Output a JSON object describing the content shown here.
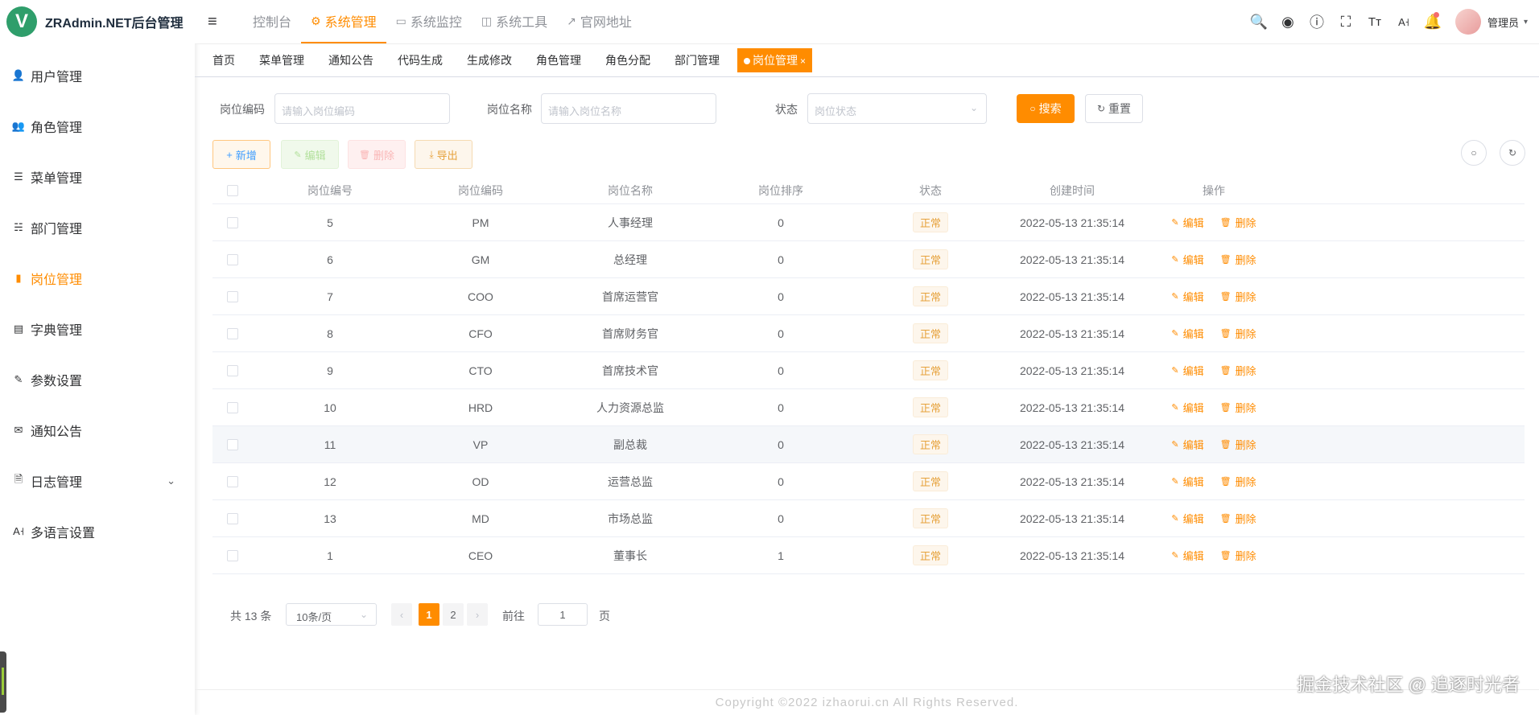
{
  "app": {
    "logo_letter": "V",
    "title": "ZRAdmin.NET后台管理"
  },
  "sidebar": {
    "items": [
      {
        "label": "用户管理",
        "icon": "user-icon"
      },
      {
        "label": "角色管理",
        "icon": "role-icon"
      },
      {
        "label": "菜单管理",
        "icon": "tree-table-icon"
      },
      {
        "label": "部门管理",
        "icon": "tree-icon"
      },
      {
        "label": "岗位管理",
        "icon": "post-icon",
        "active": true
      },
      {
        "label": "字典管理",
        "icon": "dict-icon"
      },
      {
        "label": "参数设置",
        "icon": "edit-icon"
      },
      {
        "label": "通知公告",
        "icon": "message-icon"
      },
      {
        "label": "日志管理",
        "icon": "log-icon",
        "has_children": true
      },
      {
        "label": "多语言设置",
        "icon": "language-icon"
      }
    ]
  },
  "topnav": {
    "tabs": [
      {
        "label": "控制台",
        "icon": ""
      },
      {
        "label": "系统管理",
        "icon": "gear-icon",
        "active": true
      },
      {
        "label": "系统监控",
        "icon": "monitor-icon"
      },
      {
        "label": "系统工具",
        "icon": "toolbox-icon"
      },
      {
        "label": "官网地址",
        "icon": "external-link-icon"
      }
    ],
    "user_name": "管理员"
  },
  "tags": {
    "items": [
      "首页",
      "菜单管理",
      "通知公告",
      "代码生成",
      "生成修改",
      "角色管理",
      "角色分配",
      "部门管理"
    ],
    "active": "岗位管理"
  },
  "search": {
    "post_code_label": "岗位编码",
    "post_code_placeholder": "请输入岗位编码",
    "post_name_label": "岗位名称",
    "post_name_placeholder": "请输入岗位名称",
    "status_label": "状态",
    "status_placeholder": "岗位状态",
    "search_btn": "搜索",
    "reset_btn": "重置"
  },
  "toolbar": {
    "add": "新增",
    "edit": "编辑",
    "delete": "删除",
    "export": "导出"
  },
  "table": {
    "headers": [
      "岗位编号",
      "岗位编码",
      "岗位名称",
      "岗位排序",
      "状态",
      "创建时间",
      "操作"
    ],
    "op_edit": "编辑",
    "op_delete": "删除",
    "rows": [
      {
        "id": "5",
        "code": "PM",
        "name": "人事经理",
        "sort": "0",
        "status": "正常",
        "time": "2022-05-13 21:35:14"
      },
      {
        "id": "6",
        "code": "GM",
        "name": "总经理",
        "sort": "0",
        "status": "正常",
        "time": "2022-05-13 21:35:14"
      },
      {
        "id": "7",
        "code": "COO",
        "name": "首席运营官",
        "sort": "0",
        "status": "正常",
        "time": "2022-05-13 21:35:14"
      },
      {
        "id": "8",
        "code": "CFO",
        "name": "首席财务官",
        "sort": "0",
        "status": "正常",
        "time": "2022-05-13 21:35:14"
      },
      {
        "id": "9",
        "code": "CTO",
        "name": "首席技术官",
        "sort": "0",
        "status": "正常",
        "time": "2022-05-13 21:35:14"
      },
      {
        "id": "10",
        "code": "HRD",
        "name": "人力资源总监",
        "sort": "0",
        "status": "正常",
        "time": "2022-05-13 21:35:14"
      },
      {
        "id": "11",
        "code": "VP",
        "name": "副总裁",
        "sort": "0",
        "status": "正常",
        "time": "2022-05-13 21:35:14"
      },
      {
        "id": "12",
        "code": "OD",
        "name": "运营总监",
        "sort": "0",
        "status": "正常",
        "time": "2022-05-13 21:35:14"
      },
      {
        "id": "13",
        "code": "MD",
        "name": "市场总监",
        "sort": "0",
        "status": "正常",
        "time": "2022-05-13 21:35:14"
      },
      {
        "id": "1",
        "code": "CEO",
        "name": "董事长",
        "sort": "1",
        "status": "正常",
        "time": "2022-05-13 21:35:14"
      }
    ]
  },
  "pagination": {
    "total": "共 13 条",
    "page_size": "10条/页",
    "pages": [
      "1",
      "2"
    ],
    "current": "1",
    "goto_label": "前往",
    "goto_value": "1",
    "page_suffix": "页"
  },
  "footer": "Copyright ©2022 izhaorui.cn All Rights Reserved.",
  "watermark": "掘金技术社区 @ 追逐时光者",
  "colors": {
    "accent": "#ff8c00",
    "status_tag": "#e6a23c",
    "logo_bg": "#2f9e6b"
  }
}
